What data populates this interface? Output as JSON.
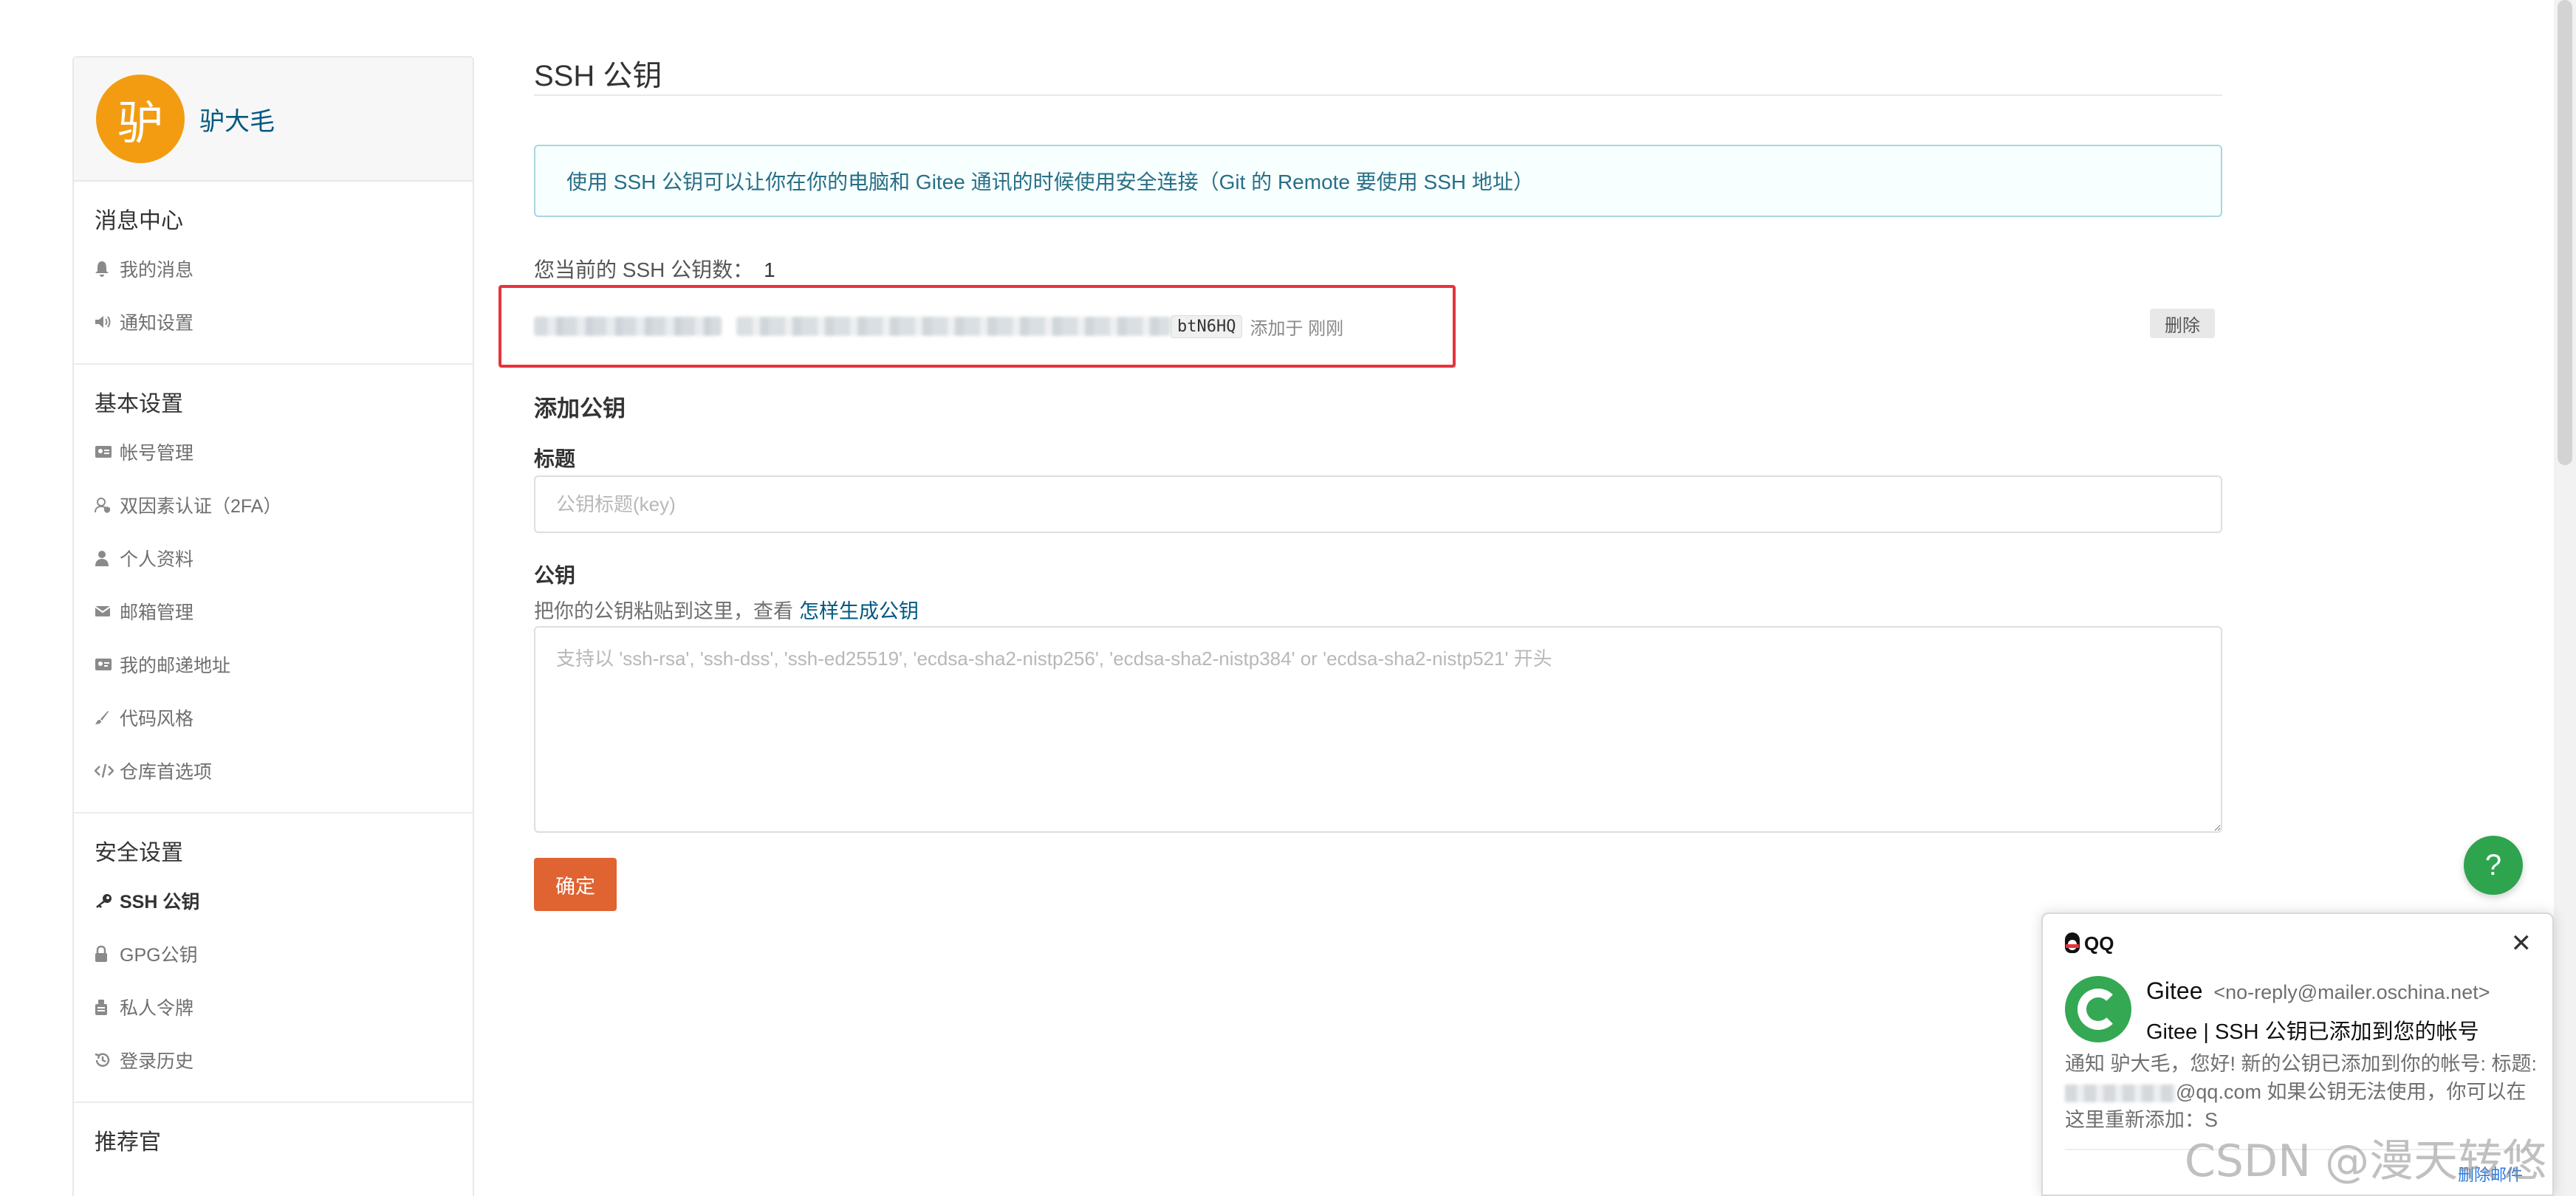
{
  "sidebar": {
    "avatar_char": "驴",
    "username": "驴大毛",
    "groups": [
      {
        "title": "消息中心",
        "items": [
          {
            "label": "我的消息",
            "icon": "bell-icon"
          },
          {
            "label": "通知设置",
            "icon": "speaker-icon"
          }
        ]
      },
      {
        "title": "基本设置",
        "items": [
          {
            "label": "帐号管理",
            "icon": "id-card-icon"
          },
          {
            "label": "双因素认证（2FA）",
            "icon": "user-shield-icon"
          },
          {
            "label": "个人资料",
            "icon": "user-icon"
          },
          {
            "label": "邮箱管理",
            "icon": "envelope-icon"
          },
          {
            "label": "我的邮递地址",
            "icon": "address-card-icon"
          },
          {
            "label": "代码风格",
            "icon": "brush-icon"
          },
          {
            "label": "仓库首选项",
            "icon": "code-icon"
          }
        ]
      },
      {
        "title": "安全设置",
        "items": [
          {
            "label": "SSH 公钥",
            "icon": "key-icon",
            "active": true
          },
          {
            "label": "GPG公钥",
            "icon": "lock-icon"
          },
          {
            "label": "私人令牌",
            "icon": "token-icon"
          },
          {
            "label": "登录历史",
            "icon": "history-icon"
          }
        ]
      },
      {
        "title": "推荐官",
        "items": []
      }
    ]
  },
  "main": {
    "title": "SSH 公钥",
    "info": "使用 SSH 公钥可以让你在你的电脑和 Gitee 通讯的时候使用安全连接（Git 的 Remote 要使用 SSH 地址）",
    "count_label": "您当前的 SSH 公钥数：",
    "count_value": "1",
    "key": {
      "fingerprint_suffix": "btN6HQ",
      "added_text": "添加于 刚刚",
      "delete_label": "删除"
    },
    "add_section_title": "添加公钥",
    "title_label": "标题",
    "title_placeholder": "公钥标题(key)",
    "key_label": "公钥",
    "key_hint": "把你的公钥粘贴到这里，查看",
    "key_hint_link": "怎样生成公钥",
    "key_placeholder": "支持以 'ssh-rsa', 'ssh-dss', 'ssh-ed25519', 'ecdsa-sha2-nistp256', 'ecdsa-sha2-nistp384' or 'ecdsa-sha2-nistp521' 开头",
    "submit_label": "确定"
  },
  "help": {
    "symbol": "?"
  },
  "qq_notification": {
    "brand": "QQ",
    "close_symbol": "✕",
    "sender_name": "Gitee",
    "sender_email": "<no-reply@mailer.oschina.net>",
    "subject": "Gitee | SSH 公钥已添加到您的帐号",
    "body_part1": "通知 驴大毛，您好! 新的公钥已添加到你的帐号: 标题:",
    "body_part2": "@qq.com 如果公钥无法使用，你可以在这里重新添加：S",
    "delete_label": "删除邮件"
  },
  "watermark": "CSDN @漫天转悠",
  "colors": {
    "accent": "#e06332",
    "link": "#005980",
    "avatar_bg": "#f39c12",
    "help_bg": "#2ea44f",
    "highlight": "#e8333a"
  }
}
